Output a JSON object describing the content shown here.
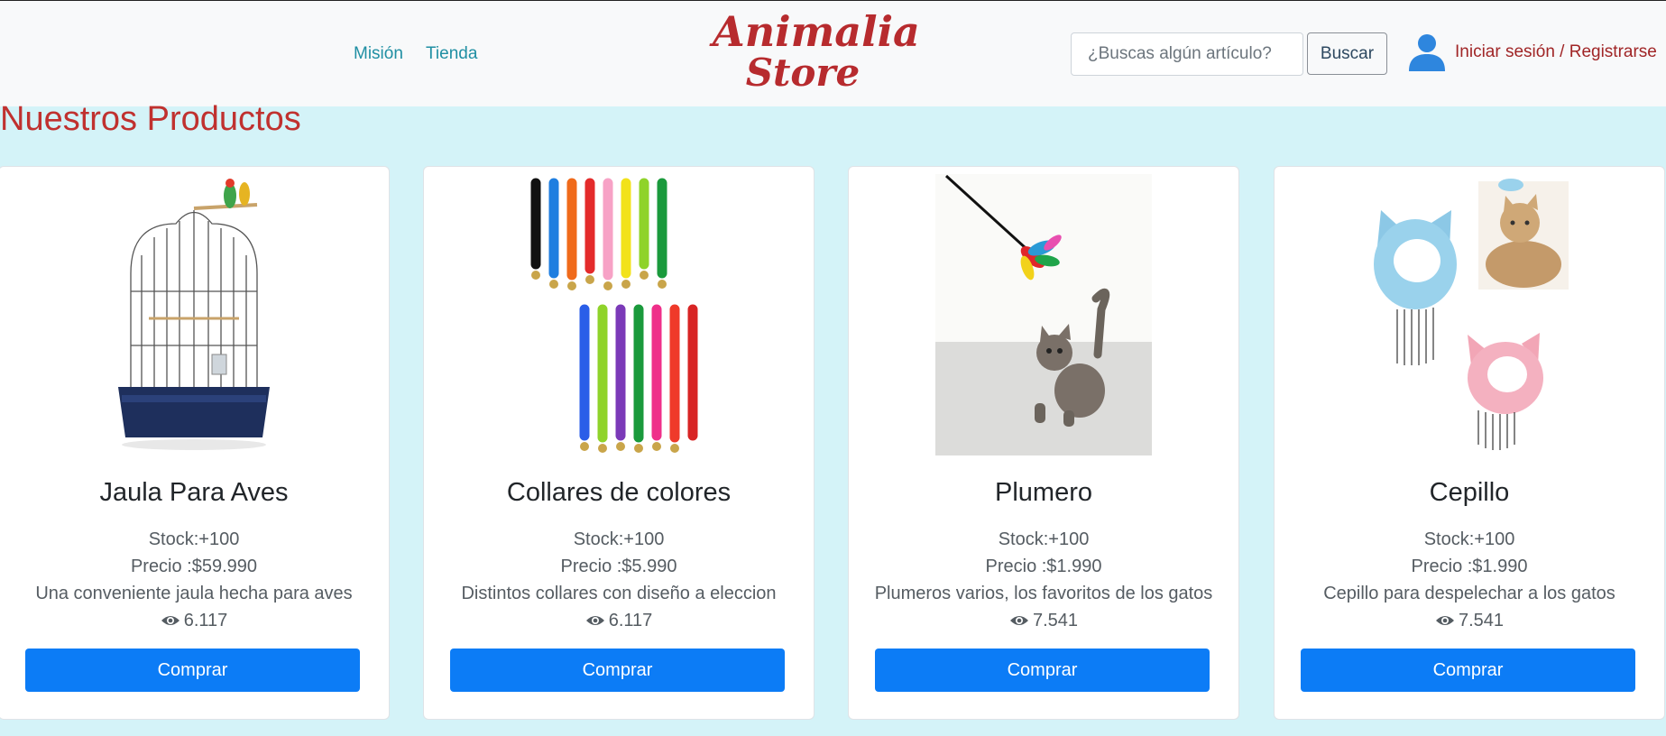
{
  "header": {
    "nav": [
      {
        "label": "Misión"
      },
      {
        "label": "Tienda"
      }
    ],
    "logo": {
      "line1": "Animalia",
      "line2": "Store"
    },
    "search": {
      "placeholder": "¿Buscas algún artículo?",
      "value": "",
      "button_label": "Buscar"
    },
    "login_label": "Iniciar sesión / Registrarse"
  },
  "main": {
    "title": "Nuestros Productos",
    "products": [
      {
        "name": "Jaula Para Aves",
        "stock": "Stock:+100",
        "price": "Precio :$59.990",
        "description": "Una conveniente jaula hecha para aves",
        "views": "6.117",
        "button_label": "Comprar",
        "image_icon": "bird-cage-image"
      },
      {
        "name": "Collares de colores",
        "stock": "Stock:+100",
        "price": "Precio :$5.990",
        "description": "Distintos collares con diseño a eleccion",
        "views": "6.117",
        "button_label": "Comprar",
        "image_icon": "colored-collars-image"
      },
      {
        "name": "Plumero",
        "stock": "Stock:+100",
        "price": "Precio :$1.990",
        "description": "Plumeros varios, los favoritos de los gatos",
        "views": "7.541",
        "button_label": "Comprar",
        "image_icon": "feather-toy-cat-image"
      },
      {
        "name": "Cepillo",
        "stock": "Stock:+100",
        "price": "Precio :$1.990",
        "description": "Cepillo para despelechar a los gatos",
        "views": "7.541",
        "button_label": "Comprar",
        "image_icon": "cat-brush-image"
      }
    ]
  },
  "colors": {
    "page_background": "#d4f3f8",
    "header_background": "#f8f9fa",
    "nav_link": "#1f8fa3",
    "brand_red": "#b72b2e",
    "button_blue": "#0c7cf6"
  }
}
